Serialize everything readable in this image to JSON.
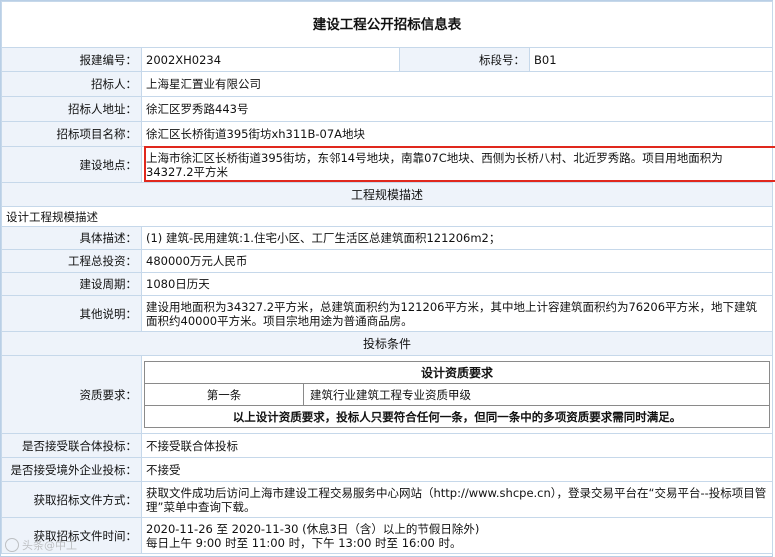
{
  "title": "建设工程公开招标信息表",
  "rows": {
    "bid_no": {
      "label": "报建编号：",
      "value": "2002XH0234"
    },
    "section_no": {
      "label": "标段号：",
      "value": "B01"
    },
    "tenderer": {
      "label": "招标人：",
      "value": "上海星汇置业有限公司"
    },
    "tenderer_address": {
      "label": "招标人地址：",
      "value": "徐汇区罗秀路443号"
    },
    "project_name": {
      "label": "招标项目名称：",
      "value": "徐汇区长桥街道395街坊xh311B-07A地块"
    },
    "site": {
      "label": "建设地点：",
      "value": "上海市徐汇区长桥街道395街坊，东邻14号地块，南靠07C地块、西侧为长桥八村、北近罗秀路。项目用地面积为34327.2平方米"
    }
  },
  "scale_section": {
    "heading": "工程规模描述",
    "subheading": "设计工程规模描述",
    "detail": {
      "label": "具体描述：",
      "value": "(1) 建筑-民用建筑:1.住宅小区、工厂生活区总建筑面积121206m2；"
    },
    "investment": {
      "label": "工程总投资：",
      "value": "480000万元人民币"
    },
    "period": {
      "label": "建设周期：",
      "value": "1080日历天"
    },
    "other": {
      "label": "其他说明：",
      "value": "建设用地面积为34327.2平方米，总建筑面积约为121206平方米，其中地上计容建筑面积约为76206平方米，地下建筑面积约40000平方米。项目宗地用途为普通商品房。"
    }
  },
  "bid_section": {
    "heading": "投标条件",
    "qualification": {
      "label": "资质要求：",
      "table_title": "设计资质要求",
      "item_no": "第一条",
      "item_text": "建筑行业建筑工程专业资质甲级",
      "note": "以上设计资质要求，投标人只要符合任何一条，但同一条中的多项资质要求需同时满足。"
    },
    "consortium": {
      "label": "是否接受联合体投标：",
      "value": "不接受联合体投标"
    },
    "foreign": {
      "label": "是否接受境外企业投标：",
      "value": "不接受"
    },
    "doc_method": {
      "label": "获取招标文件方式：",
      "value": "获取文件成功后访问上海市建设工程交易服务中心网站（http://www.shcpe.cn），登录交易平台在“交易平台--投标项目管理”菜单中查询下载。"
    },
    "doc_time": {
      "label": "获取招标文件时间：",
      "line1": "2020-11-26 至 2020-11-30 (休息3日（含）以上的节假日除外)",
      "line2": "每日上午 9:00 时至 11:00 时，下午 13:00 时至 16:00 时。"
    }
  },
  "watermark": "头条@中工"
}
